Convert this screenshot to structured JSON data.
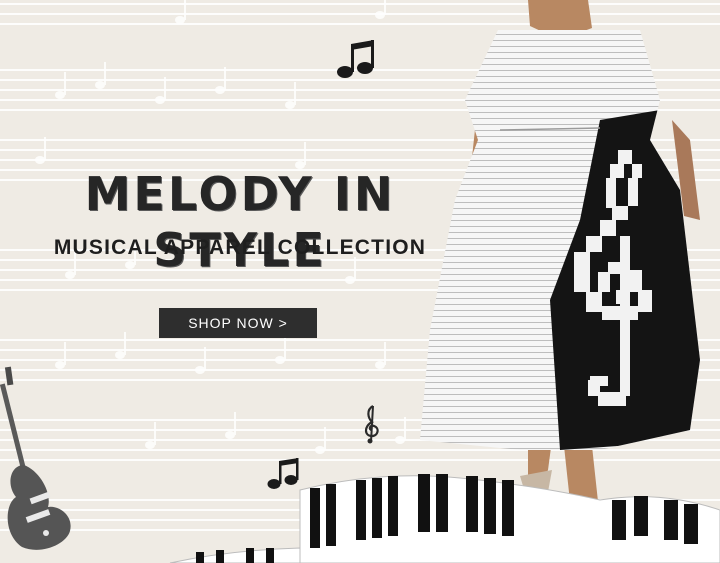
{
  "banner": {
    "headline": "MELODY IN STYLE",
    "subheadline": "MUSICAL APPAREL COLLECTION",
    "cta_label": "SHOP NOW >"
  },
  "colors": {
    "background": "#efebe4",
    "staff_lines": "#ffffff",
    "text_dark": "#262626",
    "button_bg": "#2e2e2e",
    "button_text": "#ffffff",
    "dress_white": "#f4f4f4",
    "dress_black": "#141414"
  },
  "icons": [
    "music-note-icon",
    "treble-clef-icon",
    "guitar-icon",
    "piano-keys-icon"
  ]
}
